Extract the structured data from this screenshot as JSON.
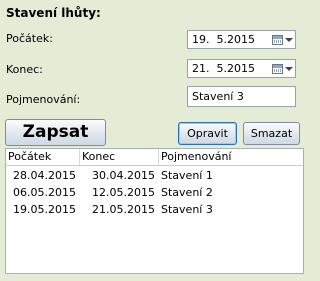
{
  "panel": {
    "title": "Stavení lhůty:"
  },
  "form": {
    "start_label": "Počátek:",
    "start_value": "19.  5.2015",
    "end_label": "Konec:",
    "end_value": "21.  5.2015",
    "name_label": "Pojmenování:",
    "name_value": "Stavení 3"
  },
  "buttons": {
    "write": "Zapsat",
    "edit": "Opravit",
    "delete": "Smazat"
  },
  "table": {
    "columns": [
      "Počátek",
      "Konec",
      "Pojmenování"
    ],
    "rows": [
      [
        "28.04.2015",
        "30.04.2015",
        "Stavení 1"
      ],
      [
        "06.05.2015",
        "12.05.2015",
        "Stavení 2"
      ],
      [
        "19.05.2015",
        "21.05.2015",
        "Stavení 3"
      ]
    ]
  },
  "icons": {
    "date_picker": "calendar-icon",
    "dropdown": "chevron-down-icon"
  },
  "colors": {
    "background": "#e4ecd6",
    "focus_border": "#2c6fb8"
  }
}
